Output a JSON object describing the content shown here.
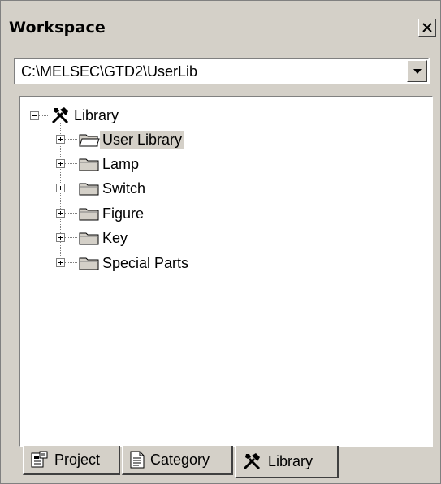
{
  "window": {
    "title": "Workspace",
    "close_icon": "close-icon"
  },
  "path_combo": {
    "value": "C:\\MELSEC\\GTD2\\UserLib",
    "arrow_icon": "chevron-down-icon"
  },
  "tree": {
    "root": {
      "label": "Library",
      "expanded": true,
      "icon": "tools-icon"
    },
    "children": [
      {
        "label": "User Library",
        "selected": true,
        "icon": "folder-open-icon",
        "expander": "plus"
      },
      {
        "label": "Lamp",
        "selected": false,
        "icon": "folder-icon",
        "expander": "plus"
      },
      {
        "label": "Switch",
        "selected": false,
        "icon": "folder-icon",
        "expander": "plus"
      },
      {
        "label": "Figure",
        "selected": false,
        "icon": "folder-icon",
        "expander": "plus"
      },
      {
        "label": "Key",
        "selected": false,
        "icon": "folder-icon",
        "expander": "plus"
      },
      {
        "label": "Special Parts",
        "selected": false,
        "icon": "folder-icon",
        "expander": "plus"
      }
    ]
  },
  "tabs": [
    {
      "label": "Project",
      "icon": "project-icon",
      "active": false
    },
    {
      "label": "Category",
      "icon": "document-icon",
      "active": false
    },
    {
      "label": "Library",
      "icon": "tools-icon",
      "active": true
    }
  ]
}
